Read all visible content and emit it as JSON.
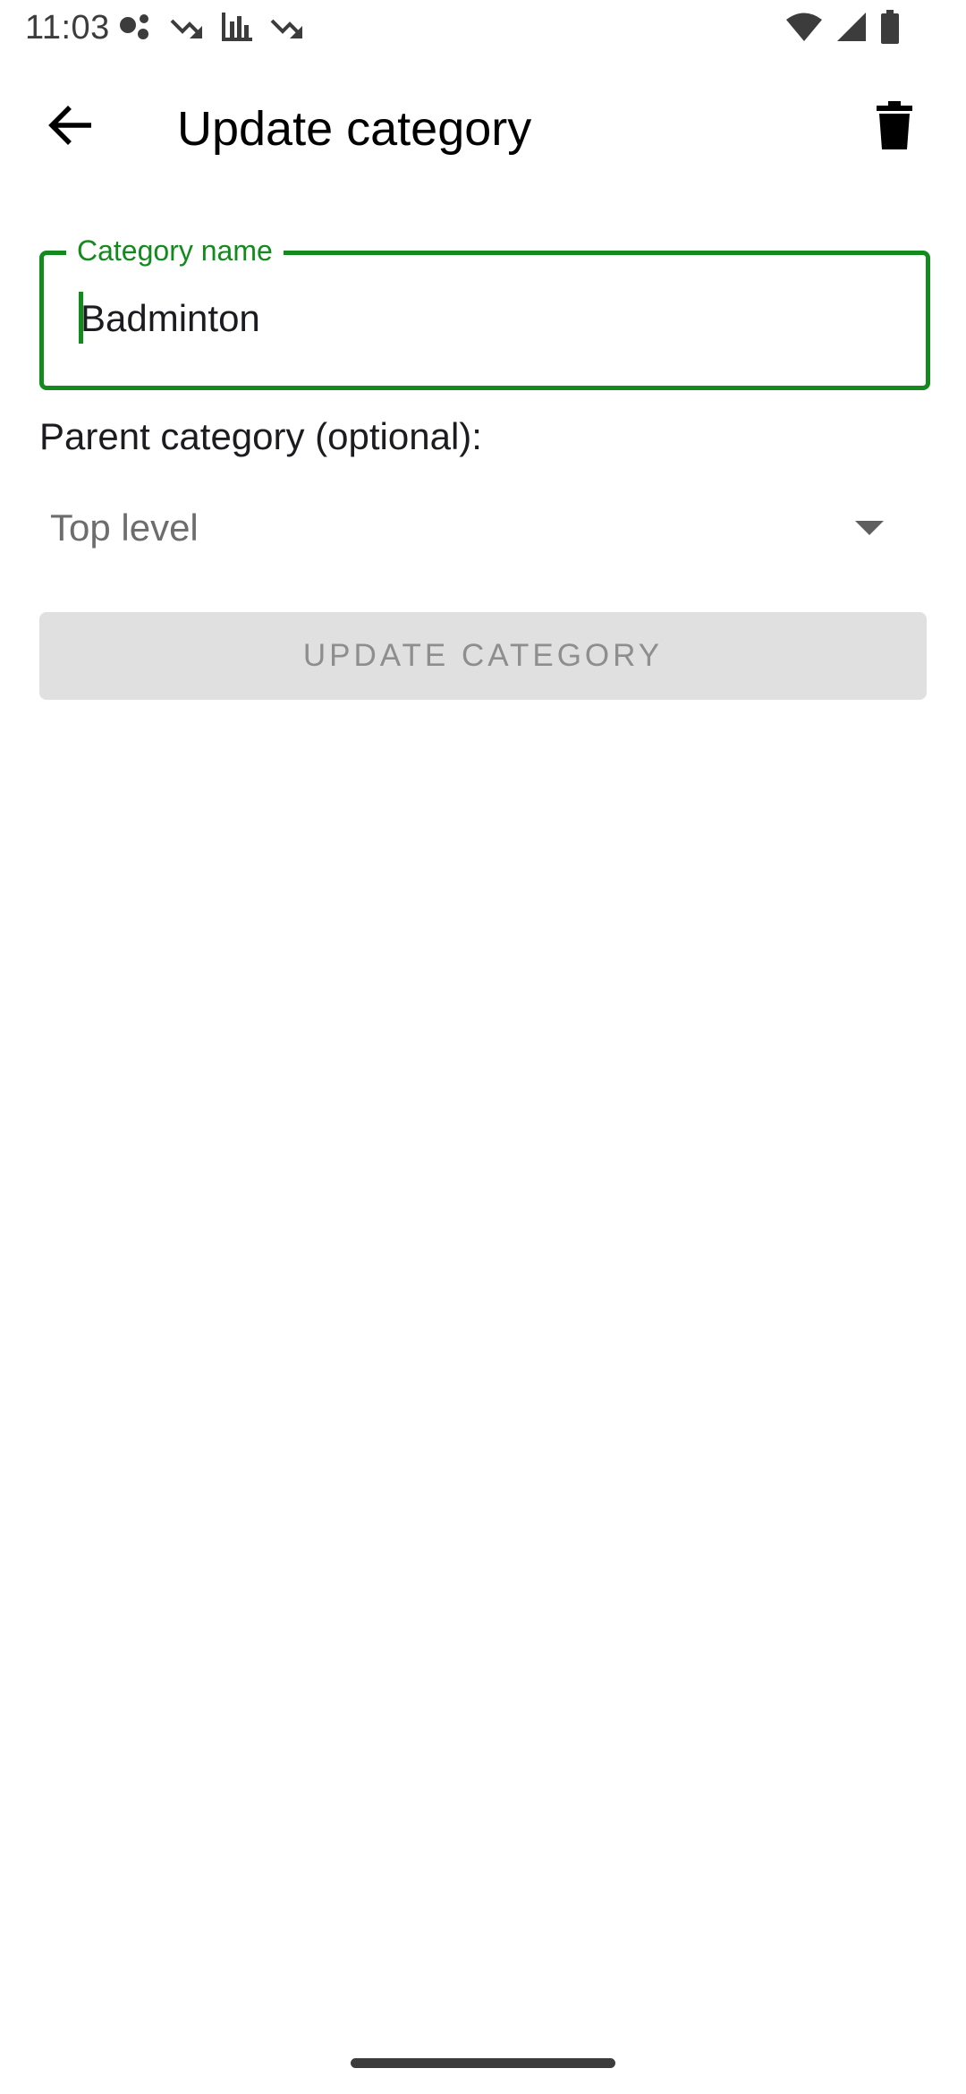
{
  "status_bar": {
    "time": "11:03",
    "left_icons": [
      "assistant-dots-icon",
      "trend-down-icon",
      "bar-chart-icon",
      "trend-down-icon"
    ],
    "right_icons": [
      "wifi-icon",
      "cellular-signal-icon",
      "battery-icon"
    ]
  },
  "app_bar": {
    "title": "Update category",
    "back_icon": "arrow-back-icon",
    "delete_icon": "trash-icon"
  },
  "form": {
    "name_field": {
      "label": "Category name",
      "value": "Badminton"
    },
    "parent_label": "Parent category (optional):",
    "parent_select": {
      "selected": "Top level"
    },
    "submit_label": "UPDATE CATEGORY"
  },
  "colors": {
    "accent": "#138a1d",
    "button_disabled_bg": "#e0e0e0",
    "button_disabled_text": "#8e8e8e"
  }
}
